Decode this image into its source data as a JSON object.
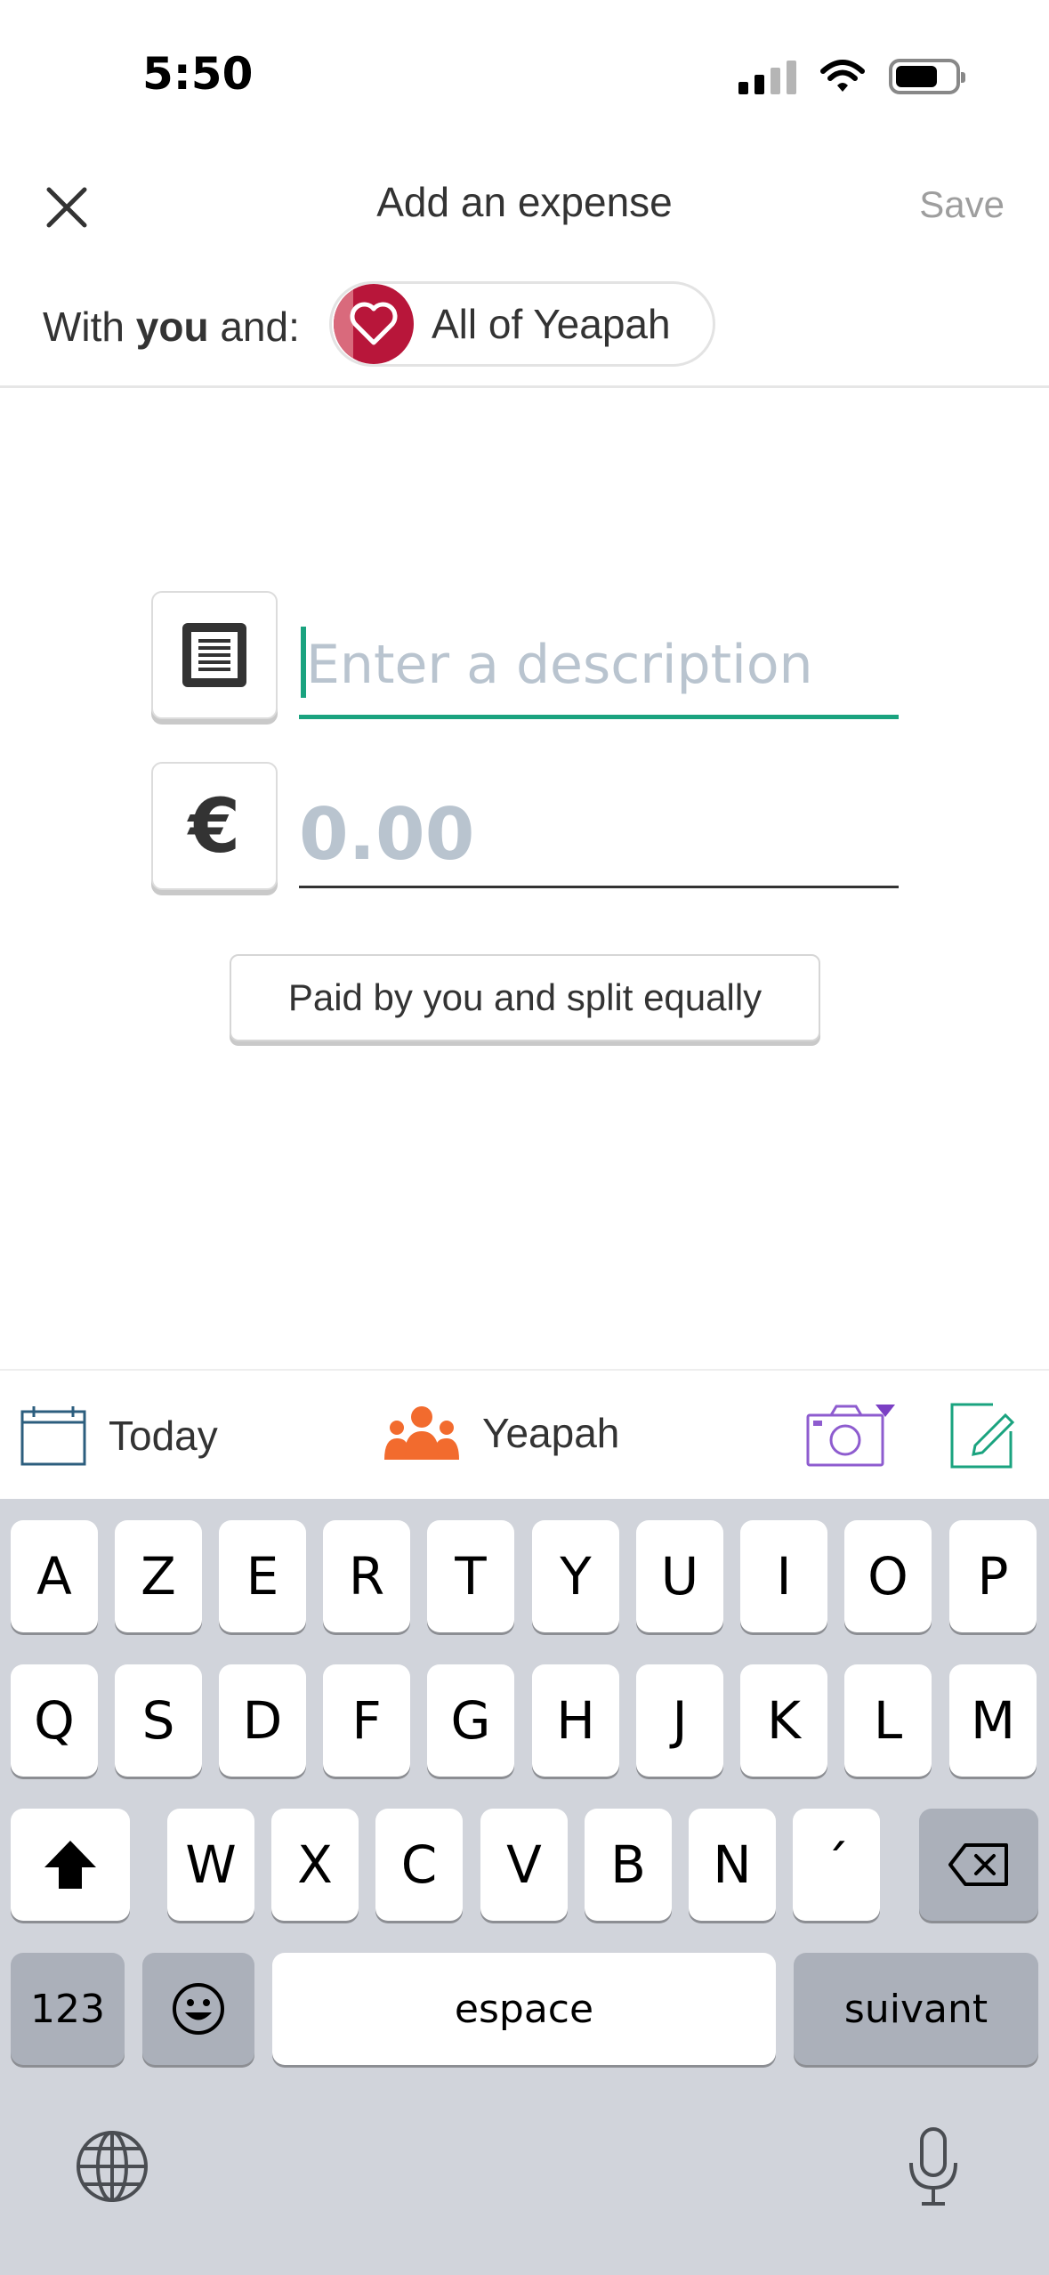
{
  "status_bar": {
    "time": "5:50"
  },
  "header": {
    "title": "Add an expense",
    "save_label": "Save"
  },
  "with_row": {
    "prefix": "With ",
    "bold": "you",
    "suffix": " and:",
    "group_name": "All of Yeapah"
  },
  "form": {
    "description_placeholder": "Enter a description",
    "amount_placeholder": "0.00",
    "currency_symbol": "€",
    "split_label": "Paid by you and split equally"
  },
  "accessory": {
    "date_label": "Today",
    "group_label": "Yeapah"
  },
  "colors": {
    "accent_green": "#1aa37f",
    "group_orange": "#f26b2e",
    "camera_purple": "#8e5ccf",
    "avatar_red": "#b8163a"
  },
  "keyboard": {
    "row1": [
      "A",
      "Z",
      "E",
      "R",
      "T",
      "Y",
      "U",
      "I",
      "O",
      "P"
    ],
    "row2": [
      "Q",
      "S",
      "D",
      "F",
      "G",
      "H",
      "J",
      "K",
      "L",
      "M"
    ],
    "row3": [
      "W",
      "X",
      "C",
      "V",
      "B",
      "N",
      "´"
    ],
    "numbers_label": "123",
    "space_label": "espace",
    "return_label": "suivant"
  }
}
